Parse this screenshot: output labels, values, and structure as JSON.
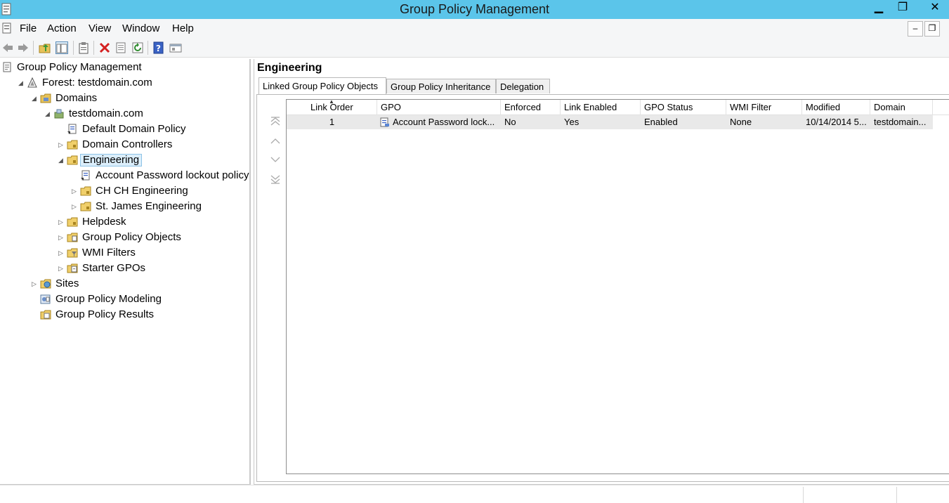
{
  "window": {
    "title": "Group Policy Management",
    "minimize_glyph": "▁",
    "maximize_glyph": "❐",
    "close_glyph": "✕"
  },
  "menu": {
    "items": [
      "File",
      "Action",
      "View",
      "Window",
      "Help"
    ],
    "mdi_minimize_glyph": "‒",
    "mdi_restore_glyph": "❐"
  },
  "toolbar": {
    "icons": [
      "back-icon",
      "forward-icon",
      "up-folder-icon",
      "show-hide-tree-icon",
      "clipboard-icon",
      "delete-icon",
      "properties-icon",
      "refresh-icon",
      "help-icon",
      "console-icon"
    ]
  },
  "tree": {
    "nodes": [
      {
        "label": "Group Policy Management",
        "icon": "gpm-root-icon",
        "expander": ""
      },
      {
        "label": "Forest: testdomain.com",
        "icon": "forest-icon",
        "expander": "◢"
      },
      {
        "label": "Domains",
        "icon": "domains-folder-icon",
        "expander": "◢"
      },
      {
        "label": "testdomain.com",
        "icon": "domain-icon",
        "expander": "◢"
      },
      {
        "label": "Default Domain Policy",
        "icon": "gpo-link-icon",
        "expander": ""
      },
      {
        "label": "Domain Controllers",
        "icon": "ou-folder-icon",
        "expander": "▷"
      },
      {
        "label": "Engineering",
        "icon": "ou-folder-icon",
        "expander": "◢"
      },
      {
        "label": "Account Password lockout policy",
        "icon": "gpo-link-icon",
        "expander": ""
      },
      {
        "label": "CH CH Engineering",
        "icon": "ou-folder-icon",
        "expander": "▷"
      },
      {
        "label": "St. James Engineering",
        "icon": "ou-folder-icon",
        "expander": "▷"
      },
      {
        "label": "Helpdesk",
        "icon": "ou-folder-icon",
        "expander": "▷"
      },
      {
        "label": "Group Policy Objects",
        "icon": "gpo-container-icon",
        "expander": "▷"
      },
      {
        "label": "WMI Filters",
        "icon": "wmi-filter-icon",
        "expander": "▷"
      },
      {
        "label": "Starter GPOs",
        "icon": "starter-gpo-icon",
        "expander": "▷"
      },
      {
        "label": "Sites",
        "icon": "sites-icon",
        "expander": "▷"
      },
      {
        "label": "Group Policy Modeling",
        "icon": "modeling-icon",
        "expander": ""
      },
      {
        "label": "Group Policy Results",
        "icon": "results-icon",
        "expander": ""
      }
    ],
    "selected": "Engineering"
  },
  "details": {
    "title": "Engineering",
    "tabs": [
      "Linked Group Policy Objects",
      "Group Policy Inheritance",
      "Delegation"
    ],
    "active_tab": "Linked Group Policy Objects",
    "columns": [
      "Link Order",
      "GPO",
      "Enforced",
      "Link Enabled",
      "GPO Status",
      "WMI Filter",
      "Modified",
      "Domain"
    ],
    "sorted_column": "Link Order",
    "rows": [
      {
        "link_order": "1",
        "gpo": "Account Password lock...",
        "enforced": "No",
        "link_enabled": "Yes",
        "gpo_status": "Enabled",
        "wmi_filter": "None",
        "modified": "10/14/2014 5...",
        "domain": "testdomain..."
      }
    ]
  },
  "colors": {
    "titlebar": "#5bc5ea",
    "selection": "#dbeefb",
    "row_highlight": "#e9e9e9"
  }
}
